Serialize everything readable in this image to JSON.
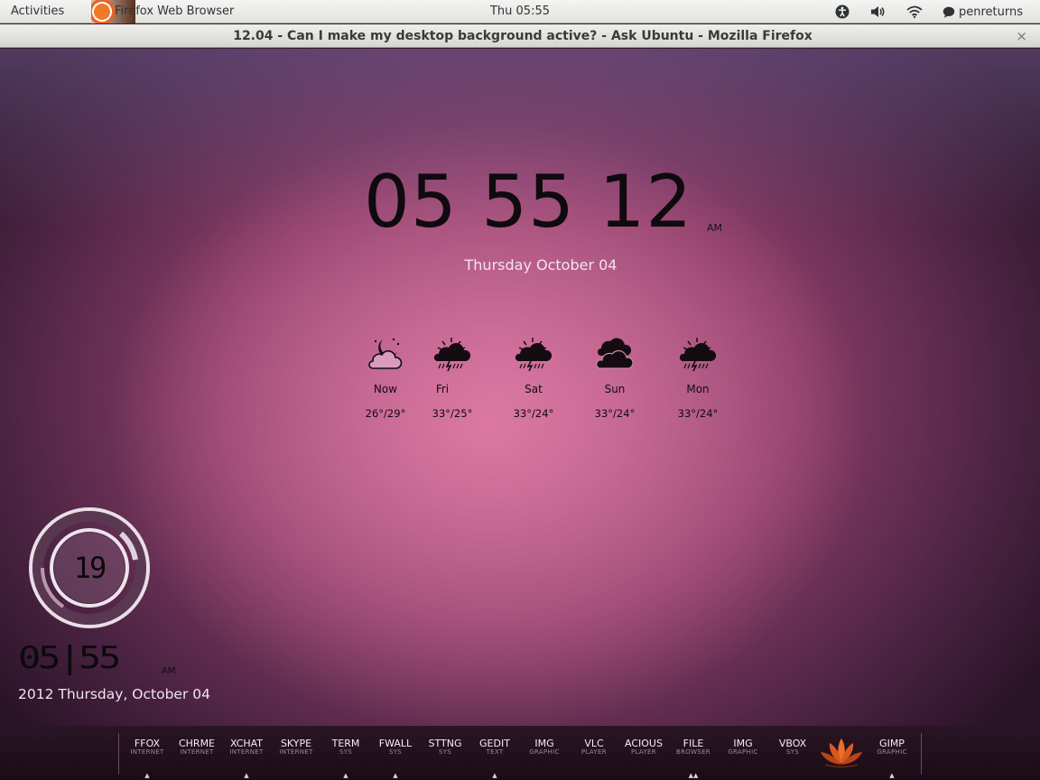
{
  "top_panel": {
    "activities": "Activities",
    "app_name": "Firefox Web Browser",
    "clock": "Thu 05:55",
    "user": "penreturns",
    "tray_icons": [
      "accessibility-icon",
      "volume-icon",
      "wifi-icon",
      "chat-icon"
    ]
  },
  "window": {
    "title": "12.04 - Can I make my desktop background active? - Ask Ubuntu - Mozilla Firefox",
    "close": "×"
  },
  "clock_widget": {
    "time": "05 55 12",
    "ampm": "AM",
    "date": "Thursday October 04"
  },
  "weather": [
    {
      "day": "Now",
      "temp": "26°/29°",
      "icon": "partly-cloudy-night-icon"
    },
    {
      "day": "Fri",
      "temp": "33°/25°",
      "icon": "thunderstorm-sun-icon"
    },
    {
      "day": "Sat",
      "temp": "33°/24°",
      "icon": "thunderstorm-sun-icon"
    },
    {
      "day": "Sun",
      "temp": "33°/24°",
      "icon": "cloudy-icon"
    },
    {
      "day": "Mon",
      "temp": "33°/24°",
      "icon": "thunderstorm-sun-icon"
    }
  ],
  "ring_widget": {
    "value": "19",
    "time": "05|55",
    "ampm": "AM",
    "date": "2012 Thursday, October 04"
  },
  "dock": {
    "items": [
      {
        "label": "FFOX",
        "sub": "INTERNET",
        "running": "▲"
      },
      {
        "label": "CHRME",
        "sub": "INTERNET",
        "running": ""
      },
      {
        "label": "XCHAT",
        "sub": "INTERNET",
        "running": "▲"
      },
      {
        "label": "SKYPE",
        "sub": "INTERNET",
        "running": ""
      },
      {
        "label": "TERM",
        "sub": "SYS",
        "running": "▲"
      },
      {
        "label": "FWALL",
        "sub": "SYS",
        "running": "▲"
      },
      {
        "label": "STTNG",
        "sub": "SYS",
        "running": ""
      },
      {
        "label": "GEDIT",
        "sub": "TEXT",
        "running": "▲"
      },
      {
        "label": "IMG",
        "sub": "GRAPHIC",
        "running": ""
      },
      {
        "label": "VLC",
        "sub": "PLAYER",
        "running": ""
      },
      {
        "label": "ACIOUS",
        "sub": "PLAYER",
        "running": ""
      },
      {
        "label": "FILE",
        "sub": "BROWSER",
        "running": "▲▲"
      },
      {
        "label": "IMG",
        "sub": "GRAPHIC",
        "running": ""
      },
      {
        "label": "VBOX",
        "sub": "SYS",
        "running": ""
      },
      {
        "label": "GIMP",
        "sub": "GRAPHIC",
        "running": "▲"
      }
    ],
    "lotus_icon": "lotus-icon"
  }
}
